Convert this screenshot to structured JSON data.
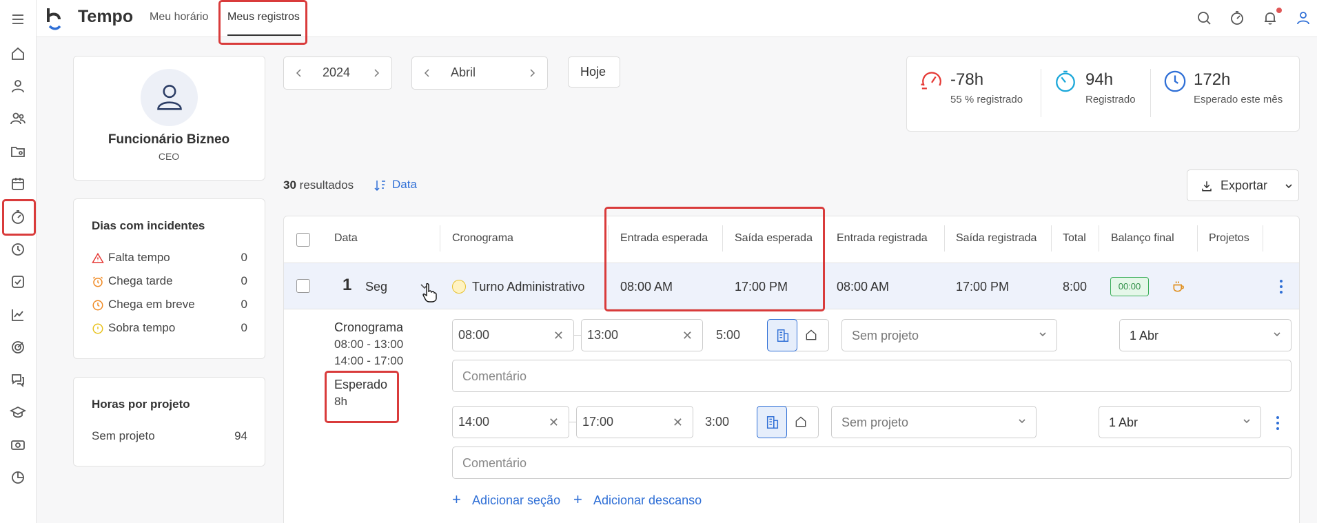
{
  "app": {
    "title": "Tempo"
  },
  "nav": {
    "tab1": "Meu horário",
    "tab2": "Meus registros"
  },
  "icons": {
    "menu": "menu-icon",
    "home": "home-icon",
    "person": "person-icon",
    "people": "people-icon",
    "folder": "folder-user-icon",
    "calendar": "calendar-icon",
    "stopwatch": "stopwatch-icon",
    "clock": "clock-icon",
    "check": "check-square-icon",
    "chart": "chart-line-icon",
    "target": "target-icon",
    "chat": "chat-icon",
    "graduation": "graduation-cap-icon",
    "money": "money-icon",
    "pie": "pie-chart-icon",
    "search": "search-icon",
    "bell": "bell-icon",
    "user": "user-icon",
    "coffee": "coffee-icon"
  },
  "colors": {
    "accent": "#2f6fd6",
    "highlight": "#d93b3b",
    "negative": "#e53935",
    "success": "#3cae5a"
  },
  "profile": {
    "name": "Funcionário Bizneo",
    "role": "CEO"
  },
  "incidents": {
    "title": "Dias com incidentes",
    "items": [
      {
        "label": "Falta tempo",
        "value": "0"
      },
      {
        "label": "Chega tarde",
        "value": "0"
      },
      {
        "label": "Chega em breve",
        "value": "0"
      },
      {
        "label": "Sobra tempo",
        "value": "0"
      }
    ]
  },
  "projects": {
    "title": "Horas por projeto",
    "item_label": "Sem projeto",
    "item_value": "94"
  },
  "filters": {
    "year": "2024",
    "month": "Abril",
    "today": "Hoje"
  },
  "stats": [
    {
      "value": "-78h",
      "label": "55 % registrado"
    },
    {
      "value": "94h",
      "label": "Registrado"
    },
    {
      "value": "172h",
      "label": "Esperado este mês"
    }
  ],
  "results": {
    "count": "30",
    "label": "resultados",
    "sort_label": "Data"
  },
  "export": {
    "label": "Exportar"
  },
  "table": {
    "headers": [
      "Data",
      "Cronograma",
      "Entrada esperada",
      "Saída esperada",
      "Entrada registrada",
      "Saída registrada",
      "Total",
      "Balanço final",
      "Projetos"
    ],
    "row": {
      "day": "1",
      "weekday": "Seg",
      "schedule": "Turno Administrativo",
      "expected_in": "08:00 AM",
      "expected_out": "17:00 PM",
      "registered_in": "08:00 AM",
      "registered_out": "17:00 PM",
      "total": "8:00",
      "balance": "00:00"
    }
  },
  "detail": {
    "schedule_label": "Cronograma",
    "schedule_1": "08:00 - 13:00",
    "schedule_2": "14:00 - 17:00",
    "expected_label": "Esperado",
    "expected_value": "8h",
    "sections": [
      {
        "start": "08:00",
        "end": "13:00",
        "duration": "5:00",
        "project": "Sem projeto",
        "date": "1 Abr",
        "comment_placeholder": "Comentário"
      },
      {
        "start": "14:00",
        "end": "17:00",
        "duration": "3:00",
        "project": "Sem projeto",
        "date": "1 Abr",
        "comment_placeholder": "Comentário"
      }
    ],
    "add_section": "Adicionar seção",
    "add_break": "Adicionar descanso"
  }
}
